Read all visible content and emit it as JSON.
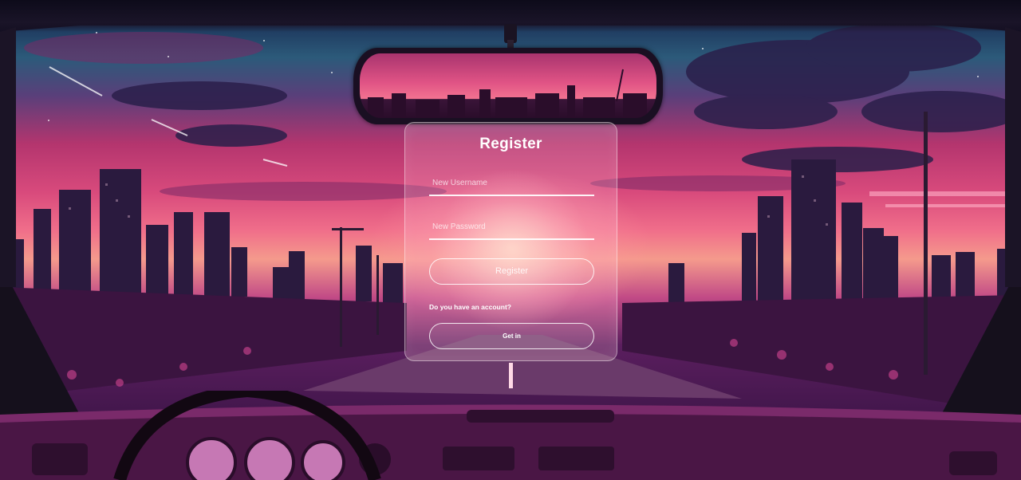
{
  "register_form": {
    "title": "Register",
    "username_placeholder": "New Username",
    "password_placeholder": "New Password",
    "register_button_label": "Register",
    "account_prompt": "Do you have an account?",
    "get_in_button_label": "Get in"
  },
  "colors": {
    "sky_top": "#0f2440",
    "sky_pink": "#d84a7c",
    "horizon_glow": "#f59a8c",
    "card_border": "#ffffff",
    "text": "#ffffff"
  }
}
